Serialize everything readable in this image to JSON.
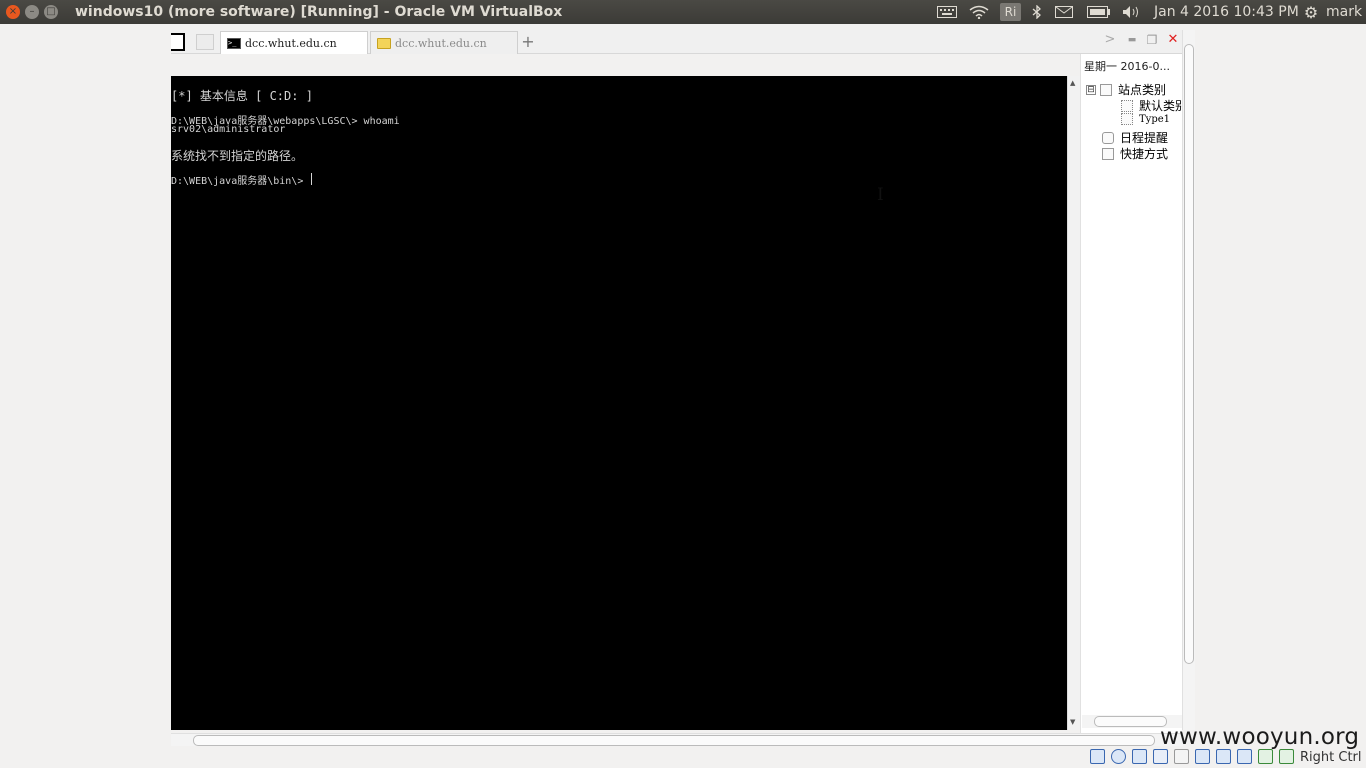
{
  "topbar": {
    "title": "windows10 (more software) [Running] - Oracle VM VirtualBox",
    "keyboard_icon": "keyboard-icon",
    "wifi_icon": "wifi-icon",
    "input_method": "Ri",
    "bluetooth_icon": "bluetooth-icon",
    "mail_icon": "mail-icon",
    "battery_icon": "battery-icon",
    "volume_icon": "volume-icon",
    "datetime": "Jan  4 2016 10:43 PM",
    "user": "mark",
    "settings_icon": "gear-icon"
  },
  "browser": {
    "tabs": [
      {
        "label": "dcc.whut.edu.cn",
        "icon": "terminal-icon",
        "active": true
      },
      {
        "label": "dcc.whut.edu.cn",
        "icon": "folder-icon",
        "active": false
      }
    ],
    "new_tab_label": "+",
    "scroll_right_label": ">",
    "minimize_label": "▬",
    "restore_label": "❐",
    "close_label": "✕"
  },
  "terminal": {
    "lines": [
      "[*] 基本信息 [ C:D: ]",
      "D:\\WEB\\java服务器\\webapps\\LGSC\\> whoami",
      "srv02\\administrator",
      "系统找不到指定的路径。",
      "D:\\WEB\\java服务器\\bin\\> "
    ]
  },
  "sidebar": {
    "date": "星期一  2016-0...",
    "tree": {
      "root_label": "站点类别",
      "root_toggle": "⊟",
      "children": [
        "默认类别",
        "Type1"
      ],
      "schedule_label": "日程提醒",
      "shortcut_label": "快捷方式"
    }
  },
  "statusbar": {
    "host_key_label": "Right Ctrl",
    "watermark": "www.wooyun.org"
  },
  "colors": {
    "topbar_bg": "#3c3b37",
    "close_button": "#e9581f",
    "terminal_bg": "#000000",
    "close_red": "#e02020"
  }
}
